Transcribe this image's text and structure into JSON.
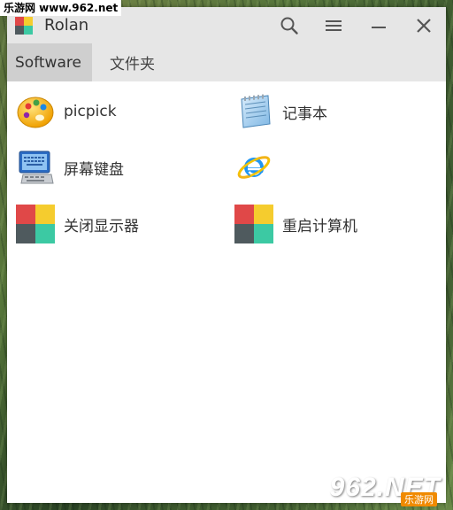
{
  "site_badge": "乐游网 www.962.net",
  "window": {
    "title": "Rolan",
    "buttons": {
      "search": "search-icon",
      "menu": "menu-icon",
      "minimize": "minimize-icon",
      "close": "close-icon"
    }
  },
  "tabs": [
    {
      "label": "Software",
      "active": true
    },
    {
      "label": "文件夹",
      "active": false
    }
  ],
  "items": [
    {
      "label": "picpick",
      "icon": "picpick-icon"
    },
    {
      "label": "记事本",
      "icon": "notepad-icon"
    },
    {
      "label": "屏幕键盘",
      "icon": "onscreen-keyboard-icon"
    },
    {
      "label": "",
      "icon": "internet-explorer-icon"
    },
    {
      "label": "关闭显示器",
      "icon": "rolan-tiles-icon"
    },
    {
      "label": "重启计算机",
      "icon": "rolan-tiles-icon"
    }
  ],
  "watermark": {
    "brand": "962.NET",
    "sub": "乐游网"
  },
  "colors": {
    "tile_red": "#e04848",
    "tile_yellow": "#f5cc2e",
    "tile_gray": "#4f5a5e",
    "tile_teal": "#3cc9a3",
    "chrome": "#e6e6e6",
    "active_tab": "#cfcfcf"
  }
}
